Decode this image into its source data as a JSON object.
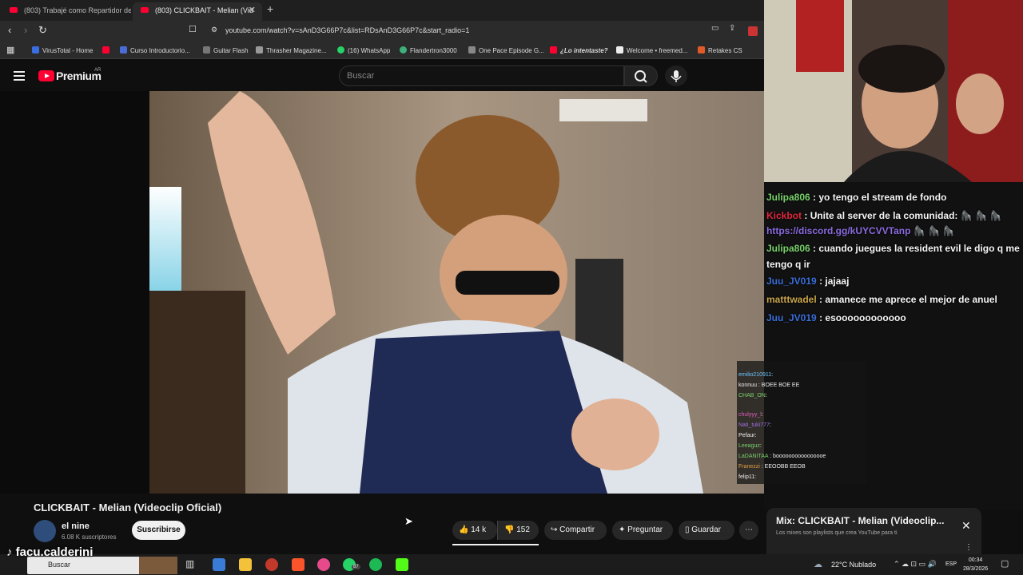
{
  "tabs": [
    {
      "label": "(803) Trabajé como Repartidor de Co"
    },
    {
      "label": "(803) CLICKBAIT - Melian (Vid"
    }
  ],
  "address": {
    "url": "youtube.com/watch?v=sAnD3G66P7c&list=RDsAnD3G66P7c&start_radio=1"
  },
  "bookmarks": [
    "VirusTotal - Home",
    "Curso Introductorio...",
    "Guitar Flash",
    "Thrasher Magazine...",
    "(16) WhatsApp",
    "Flandertron3000",
    "One Pace Episode G...",
    "¿Lo intentaste?",
    "Welcome • freemed...",
    "Retakes CS"
  ],
  "header": {
    "logo": "Premium",
    "region": "AR",
    "search_placeholder": "Buscar"
  },
  "video": {
    "title": "CLICKBAIT - Melian (Videoclip Oficial)",
    "channel": "el nine",
    "subscribers": "6.08 K suscriptores",
    "subscribe_label": "Suscribirse",
    "likes": "14 k",
    "dislikes": "152",
    "share_label": "Compartir",
    "ask_label": "Preguntar",
    "save_label": "Guardar"
  },
  "chat": [
    {
      "user": "Julipa806",
      "text": ": yo tengo el stream de fondo"
    },
    {
      "user": "Kickbot",
      "text": ": Unite al server de la comunidad:"
    },
    {
      "user": "",
      "text": "https://discord.gg/kUYCVVTanp"
    },
    {
      "user": "Julipa806",
      "text": ": cuando juegues la resident evil le digo q me"
    },
    {
      "user": "",
      "text": "tengo q ir"
    },
    {
      "user": "Juu_JV019",
      "text": ": jajaaj"
    },
    {
      "user": "matttwadel",
      "text": ": amanece me aprece el mejor de anuel"
    },
    {
      "user": "Juu_JV019",
      "text": ": esoooooooooooo"
    }
  ],
  "mini_chat": [
    {
      "user": "emilio210911",
      "text": ":"
    },
    {
      "user": "konnuu",
      "text": ": BOEE BOE EE"
    },
    {
      "user": "CHAB_ON",
      "text": ":"
    },
    {
      "user": "chulyyy_l",
      "text": ":"
    },
    {
      "user": "Nati_tuki777",
      "text": ":"
    },
    {
      "user": "Pefaur",
      "text": ":"
    },
    {
      "user": "Leeaguz",
      "text": ":"
    },
    {
      "user": "LaDANITAA",
      "text": ": boooooooooooooooe"
    },
    {
      "user": "Franezzi",
      "text": ": EEOOBB  EEOB"
    },
    {
      "user": "felip11",
      "text": ":"
    }
  ],
  "mix": {
    "title": "Mix: CLICKBAIT - Melian (Videoclip...",
    "description": "Los mixes son playlists que crea YouTube para ti"
  },
  "overlay": {
    "tiktok_handle": "facu.calderini"
  },
  "taskbar": {
    "search_placeholder": "Buscar",
    "whatsapp_badge": "87",
    "weather": "22°C  Nublado",
    "lang": "ESP",
    "time": "00:34",
    "date": "28/3/2026"
  },
  "colors": {
    "youtube_red": "#ff0033",
    "chat_user_green": "#7ad26b",
    "link_purple": "#8a6be0"
  }
}
